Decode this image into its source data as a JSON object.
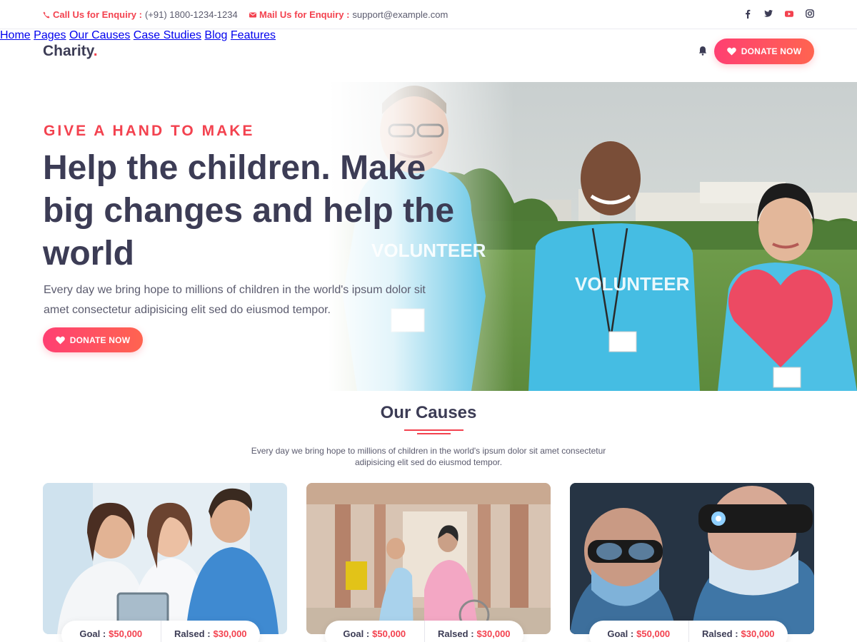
{
  "topbar": {
    "call_label": "Call Us for Enquiry :",
    "call_value": "(+91) 1800-1234-1234",
    "mail_label": "Mail Us for Enquiry :",
    "mail_value": "support@example.com",
    "socials": [
      "facebook-icon",
      "twitter-icon",
      "youtube-icon",
      "instagram-icon"
    ]
  },
  "header": {
    "logo_text": "Charity",
    "logo_dot": ".",
    "nav": [
      "Home",
      "Pages",
      "Our Causes",
      "Case Studies",
      "Blog",
      "Features"
    ],
    "donate_label": "DONATE NOW"
  },
  "hero": {
    "eyebrow": "GIVE A HAND TO MAKE",
    "title": "Help the children. Make big changes and help the world",
    "description": "Every day we bring hope to millions of children in the world's ipsum dolor sit amet consectetur adipisicing elit sed do eiusmod tempor.",
    "donate_label": "DONATE NOW",
    "photo_text": "VOLUNTEER"
  },
  "causes": {
    "title": "Our Causes",
    "description": "Every day we bring hope to millions of children in the world's ipsum dolor sit amet consectetur adipisicing elit sed do eiusmod tempor.",
    "cards": [
      {
        "goal_label": "Goal :",
        "goal": "$50,000",
        "raised_label": "Ralsed :",
        "raised": "$30,000"
      },
      {
        "goal_label": "Goal :",
        "goal": "$50,000",
        "raised_label": "Ralsed :",
        "raised": "$30,000"
      },
      {
        "goal_label": "Goal :",
        "goal": "$50,000",
        "raised_label": "Ralsed :",
        "raised": "$30,000"
      }
    ]
  },
  "colors": {
    "accent": "#f3424f",
    "heading": "#3c3c55",
    "button_gradient_start": "#ff3f72",
    "button_gradient_end": "#ff6450"
  }
}
